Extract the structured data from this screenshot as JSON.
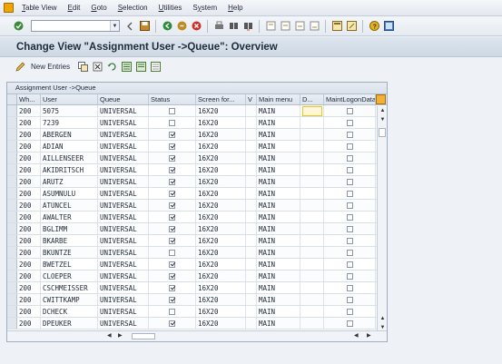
{
  "menu": {
    "items": [
      {
        "key": "table-view",
        "prefix": "",
        "ul": "T",
        "rest": "able View"
      },
      {
        "key": "edit",
        "prefix": "",
        "ul": "E",
        "rest": "dit"
      },
      {
        "key": "goto",
        "prefix": "",
        "ul": "G",
        "rest": "oto"
      },
      {
        "key": "selection",
        "prefix": "",
        "ul": "S",
        "rest": "election"
      },
      {
        "key": "utilities",
        "prefix": "",
        "ul": "U",
        "rest": "tilities"
      },
      {
        "key": "system",
        "prefix": "S",
        "ul": "y",
        "rest": "stem"
      },
      {
        "key": "help",
        "prefix": "",
        "ul": "H",
        "rest": "elp"
      }
    ]
  },
  "toolbar": {
    "command_value": ""
  },
  "title": "Change View \"Assignment User ->Queue\": Overview",
  "apptoolbar": {
    "new_entries": "New Entries"
  },
  "table": {
    "title": "Assignment User ->Queue",
    "headers": {
      "wh": "Wh...",
      "user": "User",
      "queue": "Queue",
      "status": "Status",
      "screen": "Screen for...",
      "v": "V",
      "menu": "Main menu",
      "d": "D...",
      "maint": "MaintLogonData"
    },
    "rows": [
      {
        "wh": "200",
        "user": "5075",
        "queue": "UNIVERSAL",
        "status": false,
        "screen": "16X20",
        "menu": "MAIN",
        "maint": false
      },
      {
        "wh": "200",
        "user": "7239",
        "queue": "UNIVERSAL",
        "status": false,
        "screen": "16X20",
        "menu": "MAIN",
        "maint": false
      },
      {
        "wh": "200",
        "user": "ABERGEN",
        "queue": "UNIVERSAL",
        "status": true,
        "screen": "16X20",
        "menu": "MAIN",
        "maint": false
      },
      {
        "wh": "200",
        "user": "ADIAN",
        "queue": "UNIVERSAL",
        "status": true,
        "screen": "16X20",
        "menu": "MAIN",
        "maint": false
      },
      {
        "wh": "200",
        "user": "AILLENSEER",
        "queue": "UNIVERSAL",
        "status": true,
        "screen": "16X20",
        "menu": "MAIN",
        "maint": false
      },
      {
        "wh": "200",
        "user": "AKIDRITSCH",
        "queue": "UNIVERSAL",
        "status": true,
        "screen": "16X20",
        "menu": "MAIN",
        "maint": false
      },
      {
        "wh": "200",
        "user": "ARUTZ",
        "queue": "UNIVERSAL",
        "status": true,
        "screen": "16X20",
        "menu": "MAIN",
        "maint": false
      },
      {
        "wh": "200",
        "user": "ASUMNULU",
        "queue": "UNIVERSAL",
        "status": true,
        "screen": "16X20",
        "menu": "MAIN",
        "maint": false
      },
      {
        "wh": "200",
        "user": "ATUNCEL",
        "queue": "UNIVERSAL",
        "status": true,
        "screen": "16X20",
        "menu": "MAIN",
        "maint": false
      },
      {
        "wh": "200",
        "user": "AWALTER",
        "queue": "UNIVERSAL",
        "status": true,
        "screen": "16X20",
        "menu": "MAIN",
        "maint": false
      },
      {
        "wh": "200",
        "user": "BGLIMM",
        "queue": "UNIVERSAL",
        "status": true,
        "screen": "16X20",
        "menu": "MAIN",
        "maint": false
      },
      {
        "wh": "200",
        "user": "BKARBE",
        "queue": "UNIVERSAL",
        "status": true,
        "screen": "16X20",
        "menu": "MAIN",
        "maint": false
      },
      {
        "wh": "200",
        "user": "BKUNTZE",
        "queue": "UNIVERSAL",
        "status": false,
        "screen": "16X20",
        "menu": "MAIN",
        "maint": false
      },
      {
        "wh": "200",
        "user": "BWETZEL",
        "queue": "UNIVERSAL",
        "status": true,
        "screen": "16X20",
        "menu": "MAIN",
        "maint": false
      },
      {
        "wh": "200",
        "user": "CLOEPER",
        "queue": "UNIVERSAL",
        "status": true,
        "screen": "16X20",
        "menu": "MAIN",
        "maint": false
      },
      {
        "wh": "200",
        "user": "CSCHMEISSER",
        "queue": "UNIVERSAL",
        "status": true,
        "screen": "16X20",
        "menu": "MAIN",
        "maint": false
      },
      {
        "wh": "200",
        "user": "CWITTKAMP",
        "queue": "UNIVERSAL",
        "status": true,
        "screen": "16X20",
        "menu": "MAIN",
        "maint": false
      },
      {
        "wh": "200",
        "user": "DCHECK",
        "queue": "UNIVERSAL",
        "status": false,
        "screen": "16X20",
        "menu": "MAIN",
        "maint": false
      },
      {
        "wh": "200",
        "user": "DPEUKER",
        "queue": "UNIVERSAL",
        "status": true,
        "screen": "16X20",
        "menu": "MAIN",
        "maint": false
      }
    ]
  },
  "colors": {
    "accent": "#f0c419",
    "title_bg": "#d5dee8",
    "background": "#eef2f7"
  }
}
